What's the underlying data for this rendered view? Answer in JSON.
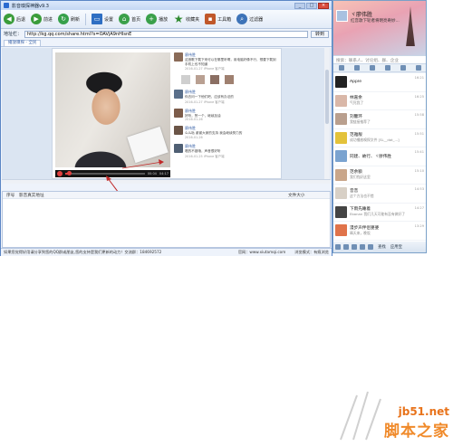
{
  "app": {
    "title": "影音嗅探神器v9.3",
    "window_buttons": [
      "_",
      "□",
      "×"
    ]
  },
  "toolbar": {
    "back_label": "后退",
    "forward_label": "前进",
    "refresh_label": "刷新",
    "settings_label": "设置",
    "home_label": "首页",
    "play_label": "播放",
    "favorites_label": "收藏夹",
    "toolbox_label": "工具箱",
    "filter_label": "过滤器"
  },
  "address": {
    "label": "地址栏：",
    "value": "http://kg.qq.com/share.html?s=OAVjA9nHIsnE",
    "go_label": "转到"
  },
  "tab": {
    "label": "播放嗅探 - 全民"
  },
  "player": {
    "time_left": "00:04",
    "time_right": "04:17"
  },
  "feed": {
    "posts": [
      {
        "name": "廖伟胜",
        "text": "这首歌下载下来可以在哪里听啊，用电脑好像不行，想要下载到手机上也不知道",
        "time": "2016-01-27 iPhone 客户端"
      },
      {
        "name": "廖伟胜",
        "text": "你去问一下他们吧，应该有办法的",
        "time": "2016-01-27 iPhone 客户端"
      },
      {
        "name": "廖伟胜",
        "text": "好听，赞一个，继续加油",
        "time": "2016-01-26"
      },
      {
        "name": "廖伟胜",
        "text": "么么哒 谢谢大家的支持 我会继续努力的",
        "time": "2016-01-26"
      },
      {
        "name": "廖伟胜",
        "text": "唱的不错哦，声音很好听",
        "time": "2016-01-25 iPhone 客户端"
      }
    ]
  },
  "list": {
    "columns": [
      "序号",
      "影音真实地址",
      "文件大小"
    ]
  },
  "status": {
    "message": "如果您觉得好用请分享到您的QQ群或朋友,您的支持是我们更新的动力！交流群：184692572",
    "site": "官网：www.xiutamqi.com",
    "mode": "浏览模式：有痕浏览"
  },
  "qq": {
    "nickname": "ヾ廖伟胜",
    "signature": "红音歌下轮者将明亮奇妙...",
    "search_placeholder": "搜索：联系人、讨论组、群、企业",
    "contacts": [
      {
        "name": "Apple",
        "msg": "",
        "time": "16:21"
      },
      {
        "name": "林嘉余",
        "msg": "气死我了",
        "time": "16:25"
      },
      {
        "name": "刘馨环",
        "msg": "我链接推荐了",
        "time": "15:58"
      },
      {
        "name": "范雅靓",
        "msg": "成功播放嗅探文件 [SL__dat_...]",
        "time": "15:51"
      },
      {
        "name": "同建、故行、ヾ廖伟胜",
        "msg": "",
        "time": "15:41"
      },
      {
        "name": "范余额",
        "msg": "我们找好这里",
        "time": "15:10"
      },
      {
        "name": "音音",
        "msg": "这个方法也不错",
        "time": "14:53"
      },
      {
        "name": "下雨先睡着",
        "msg": "Ebanan 我们几天可能有没有做好了",
        "time": "14:27"
      },
      {
        "name": "漫步声伴侣婆婆",
        "msg": "晴天来，晚饭",
        "time": "13:29"
      }
    ],
    "bottom_find": "查找",
    "bottom_app": "应用宝"
  },
  "watermark": {
    "url": "jb51.net",
    "cn": "脚本之家"
  },
  "colors": {
    "accent": "#2a6ad0",
    "highlight_red": "#e04040",
    "watermark": "#e8731b"
  }
}
